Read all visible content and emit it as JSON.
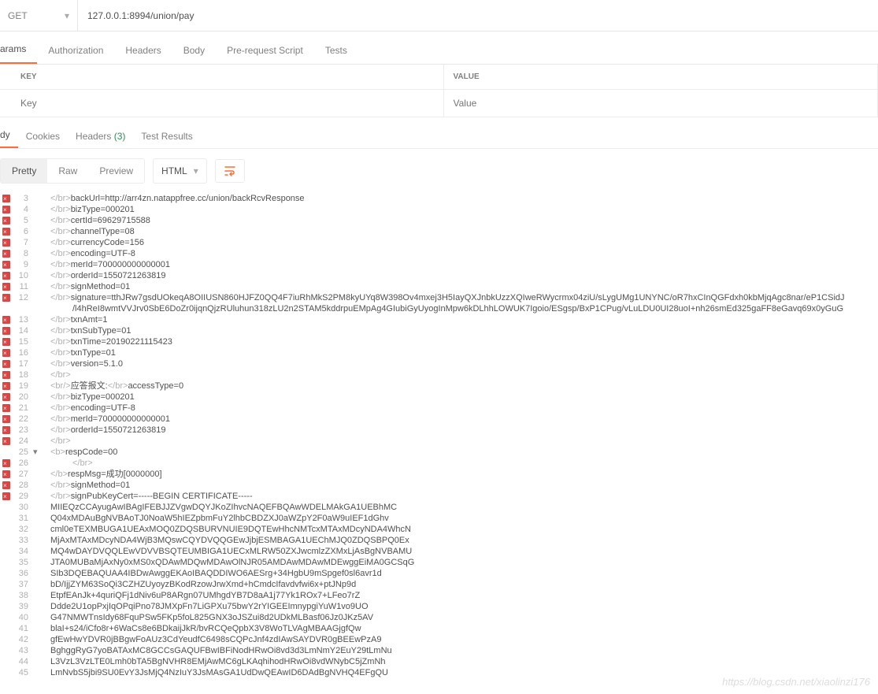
{
  "request": {
    "method": "GET",
    "url": "127.0.0.1:8994/union/pay"
  },
  "reqTabs": {
    "active": "arams",
    "items": [
      "arams",
      "Authorization",
      "Headers",
      "Body",
      "Pre-request Script",
      "Tests"
    ]
  },
  "kvHeaders": {
    "key": "KEY",
    "value": "VALUE"
  },
  "kvPlaceholders": {
    "key": "Key",
    "value": "Value"
  },
  "respTabs": {
    "active": "dy",
    "items": [
      {
        "label": "dy"
      },
      {
        "label": "Cookies"
      },
      {
        "label": "Headers",
        "count": "(3)"
      },
      {
        "label": "Test Results"
      }
    ]
  },
  "viewModes": {
    "items": [
      "Pretty",
      "Raw",
      "Preview"
    ],
    "active": "Pretty"
  },
  "formatSelect": "HTML",
  "codeLines": [
    {
      "n": 3,
      "err": true,
      "pre": "</br>",
      "txt": "backUrl=http://arr4zn.natappfree.cc/union/backRcvResponse"
    },
    {
      "n": 4,
      "err": true,
      "pre": "</br>",
      "txt": "bizType=000201"
    },
    {
      "n": 5,
      "err": true,
      "pre": "</br>",
      "txt": "certId=69629715588"
    },
    {
      "n": 6,
      "err": true,
      "pre": "</br>",
      "txt": "channelType=08"
    },
    {
      "n": 7,
      "err": true,
      "pre": "</br>",
      "txt": "currencyCode=156"
    },
    {
      "n": 8,
      "err": true,
      "pre": "</br>",
      "txt": "encoding=UTF-8"
    },
    {
      "n": 9,
      "err": true,
      "pre": "</br>",
      "txt": "merId=700000000000001"
    },
    {
      "n": 10,
      "err": true,
      "pre": "</br>",
      "txt": "orderId=1550721263819"
    },
    {
      "n": 11,
      "err": true,
      "pre": "</br>",
      "txt": "signMethod=01"
    },
    {
      "n": 12,
      "err": true,
      "pre": "</br>",
      "txt": "signature=tthJRw7gsdUOkeqA8OIIUSN860HJFZ0QQ4F7iuRhMkS2PM8kyUYq8W398Ov4mxej3H5IayQXJnbkUzzXQIweRWycrmx04ziU/sLygUMg1UNYNC/oR7hxCInQGFdxh0kbMjqAgc8nar/eP1CSidJ"
    },
    {
      "n": "",
      "err": false,
      "pre": "",
      "txt": "/l4hReI8wmtVVJrv0SbE6DoZr0ijqnQjzRUluhun318zLU2n2STAM5kddrpuEMpAg4GIubiGyUyogInMpw6kDLhhLOWUK7Igoio/ESgsp/BxP1CPug/vLuLDU0UI28uoI+nh26smEd325gaFF8eGavq69x0yGuG",
      "indent": true
    },
    {
      "n": 13,
      "err": true,
      "pre": "</br>",
      "txt": "txnAmt=1"
    },
    {
      "n": 14,
      "err": true,
      "pre": "</br>",
      "txt": "txnSubType=01"
    },
    {
      "n": 15,
      "err": true,
      "pre": "</br>",
      "txt": "txnTime=20190221115423"
    },
    {
      "n": 16,
      "err": true,
      "pre": "</br>",
      "txt": "txnType=01"
    },
    {
      "n": 17,
      "err": true,
      "pre": "</br>",
      "txt": "version=5.1.0"
    },
    {
      "n": 18,
      "err": true,
      "pre": "</br>",
      "txt": ""
    },
    {
      "n": 19,
      "err": true,
      "pre": "<br/>",
      "mid": "应答报文:",
      "post": "</br>",
      "txt": "accessType=0"
    },
    {
      "n": 20,
      "err": true,
      "pre": "</br>",
      "txt": "bizType=000201"
    },
    {
      "n": 21,
      "err": true,
      "pre": "</br>",
      "txt": "encoding=UTF-8"
    },
    {
      "n": 22,
      "err": true,
      "pre": "</br>",
      "txt": "merId=700000000000001"
    },
    {
      "n": 23,
      "err": true,
      "pre": "</br>",
      "txt": "orderId=1550721263819"
    },
    {
      "n": 24,
      "err": true,
      "pre": "</br>",
      "txt": ""
    },
    {
      "n": 25,
      "err": false,
      "fold": "▾",
      "pre": "<b>",
      "txt": "respCode=00"
    },
    {
      "n": 26,
      "err": true,
      "pre": "</br>",
      "txt": "",
      "indent": true
    },
    {
      "n": 27,
      "err": true,
      "pre": "</b>",
      "txt": "respMsg=成功[0000000]"
    },
    {
      "n": 28,
      "err": true,
      "pre": "</br>",
      "txt": "signMethod=01"
    },
    {
      "n": 29,
      "err": true,
      "pre": "</br>",
      "txt": "signPubKeyCert=-----BEGIN CERTIFICATE-----"
    },
    {
      "n": 30,
      "err": false,
      "pre": "",
      "txt": "MIIEQzCCAyugAwIBAgIFEBJJZVgwDQYJKoZIhvcNAQEFBQAwWDELMAkGA1UEBhMC"
    },
    {
      "n": 31,
      "err": false,
      "pre": "",
      "txt": "Q04xMDAuBgNVBAoTJ0NoaW5hIEZpbmFuY2lhbCBDZXJ0aWZpY2F0aW9uIEF1dGhv"
    },
    {
      "n": 32,
      "err": false,
      "pre": "",
      "txt": "cml0eTEXMBUGA1UEAxMOQ0ZDQSBURVNUIE9DQTEwHhcNMTcxMTAxMDcyNDA4WhcN"
    },
    {
      "n": 33,
      "err": false,
      "pre": "",
      "txt": "MjAxMTAxMDcyNDA4WjB3MQswCQYDVQQGEwJjbjESMBAGA1UEChMJQ0ZDQSBPQ0Ex"
    },
    {
      "n": 34,
      "err": false,
      "pre": "",
      "txt": "MQ4wDAYDVQQLEwVDVVBSQTEUMBIGA1UECxMLRW50ZXJwcmlzZXMxLjAsBgNVBAMU"
    },
    {
      "n": 35,
      "err": false,
      "pre": "",
      "txt": "JTA0MUBaMjAxNy0xMS0xQDAwMDQwMDAwOlNJR05AMDAwMDAwMDEwggEiMA0GCSqG"
    },
    {
      "n": 36,
      "err": false,
      "pre": "",
      "txt": "SIb3DQEBAQUAA4IBDwAwggEKAoIBAQDDIWO6AESrg+34HgbU9mSpgef0sl6avr1d"
    },
    {
      "n": 37,
      "err": false,
      "pre": "",
      "txt": "bD/IjjZYM63SoQi3CZHZUyoyzBKodRzowJrwXmd+hCmdcIfavdvfwi6x+ptJNp9d"
    },
    {
      "n": 38,
      "err": false,
      "pre": "",
      "txt": "EtpfEAnJk+4quriQFj1dNiv6uP8ARgn07UMhgdYB7D8aA1j77Yk1ROx7+LFeo7rZ"
    },
    {
      "n": 39,
      "err": false,
      "pre": "",
      "txt": "Ddde2U1opPxjIqOPqiPno78JMXpFn7LiGPXu75bwY2rYIGEEImnypgiYuW1vo9UO"
    },
    {
      "n": 40,
      "err": false,
      "pre": "",
      "txt": "G47NMWTnsIdy68FquPSw5FKp5foL825GNX3oJSZui8d2UDkMLBasf06Jz0JKz5AV"
    },
    {
      "n": 41,
      "err": false,
      "pre": "",
      "txt": "blaI+s24/iCfo8r+6WaCs8e6BDkaijJkR/bvRCQeQpbX3V8WoTLVAgMBAAGjgfQw"
    },
    {
      "n": 42,
      "err": false,
      "pre": "",
      "txt": "gfEwHwYDVR0jBBgwFoAUz3CdYeudfC6498sCQPcJnf4zdIAwSAYDVR0gBEEwPzA9"
    },
    {
      "n": 43,
      "err": false,
      "pre": "",
      "txt": "BghggRyG7yoBATAxMC8GCCsGAQUFBwIBFiNodHRwOi8vd3d3LmNmY2EuY29tLmNu"
    },
    {
      "n": 44,
      "err": false,
      "pre": "",
      "txt": "L3VzL3VzLTE0Lmh0bTA5BgNVHR8EMjAwMC6gLKAqhihodHRwOi8vdWNybC5jZmNh"
    },
    {
      "n": 45,
      "err": false,
      "pre": "",
      "txt": "LmNvbS5jbi9SU0EvY3JsMjQ4NzIuY3JsMAsGA1UdDwQEAwID6DAdBgNVHQ4EFgQU"
    }
  ],
  "watermark": "https://blog.csdn.net/xiaolinzi176"
}
